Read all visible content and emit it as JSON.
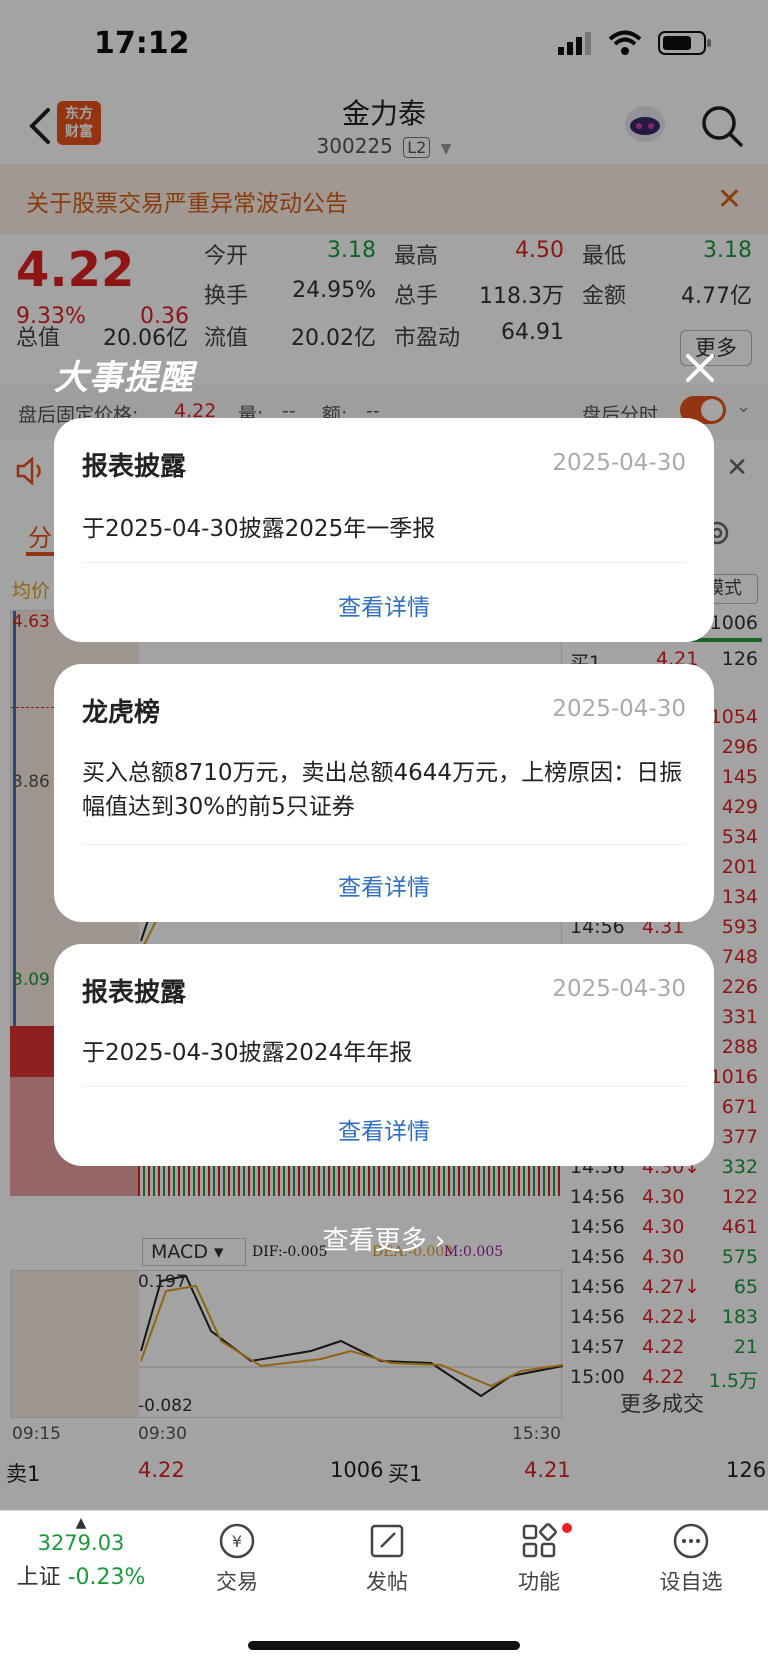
{
  "status": {
    "time": "17:12"
  },
  "nav": {
    "logo_line1": "东方",
    "logo_line2": "财富",
    "name": "金力泰",
    "code": "300225",
    "level": "L2"
  },
  "notice": {
    "text": "关于股票交易严重异常波动公告"
  },
  "quote": {
    "price": "4.22",
    "pct": "9.33%",
    "change": "0.36",
    "open_label": "今开",
    "open": "3.18",
    "high_label": "最高",
    "high": "4.50",
    "low_label": "最低",
    "low": "3.18",
    "turnover_label": "换手",
    "turnover": "24.95%",
    "volume_label": "总手",
    "volume": "118.3万",
    "amount_label": "金额",
    "amount": "4.77亿",
    "mktcap_label": "总值",
    "mktcap": "20.06亿",
    "float_label": "流值",
    "float": "20.02亿",
    "pe_label": "市盈动",
    "pe": "64.91",
    "more": "更多"
  },
  "after": {
    "label": "盘后固定价格:",
    "price": "4.22",
    "vol": "量:",
    "vol_v": "--",
    "amt": "额:",
    "amt_v": "--",
    "right": "盘后分时"
  },
  "tabs": {
    "first": "分",
    "mode": "模式"
  },
  "chart": {
    "avg_label": "均价",
    "y_top": "4.63",
    "y_mid": "3.86",
    "y_bot": "3.09",
    "macd": "MACD",
    "dif": "DIF:-0.005",
    "dea": "DEA:-0.008",
    "m": "M:0.005",
    "macd_top": "0.197",
    "macd_bot": "-0.082",
    "t0": "09:15",
    "t1": "09:30",
    "t2": "15:30"
  },
  "book_top": {
    "sell1_vol": "1006",
    "buy1": "买1",
    "buy1_price": "4.21",
    "buy1_vol": "126"
  },
  "ticks_hidden_right": [
    "1054",
    "296",
    "145",
    "429",
    "534",
    "201",
    "134"
  ],
  "ticks": [
    {
      "time": "14:56",
      "price": "4.31",
      "vol": "593"
    },
    {
      "time": "",
      "price": "",
      "vol": "748"
    },
    {
      "time": "",
      "price": "",
      "vol": "226"
    },
    {
      "time": "",
      "price": "",
      "vol": "331"
    },
    {
      "time": "",
      "price": "",
      "vol": "288"
    },
    {
      "time": "",
      "price": "",
      "vol": "1016"
    },
    {
      "time": "",
      "price": "",
      "vol": "671"
    },
    {
      "time": "",
      "price": "",
      "vol": "377"
    },
    {
      "time": "14:56",
      "price": "4.30↓",
      "vol": "332"
    },
    {
      "time": "14:56",
      "price": "4.30",
      "vol": "122"
    },
    {
      "time": "14:56",
      "price": "4.30",
      "vol": "461"
    },
    {
      "time": "14:56",
      "price": "4.30",
      "vol": "575"
    },
    {
      "time": "14:56",
      "price": "4.27↓",
      "vol": "65"
    },
    {
      "time": "14:56",
      "price": "4.22↓",
      "vol": "183"
    },
    {
      "time": "14:57",
      "price": "4.22",
      "vol": "21"
    },
    {
      "time": "15:00",
      "price": "4.22",
      "vol": "1.5万"
    }
  ],
  "more_trades": "更多成交",
  "orders": {
    "sell1": "卖1",
    "sell1_price": "4.22",
    "sell1_vol": "1006",
    "buy1": "买1",
    "buy1_price": "4.21",
    "buy1_vol": "126"
  },
  "bottom": {
    "index_value": "3279.03",
    "index_name": "上证",
    "index_pct": "-0.23%",
    "trade": "交易",
    "post": "发帖",
    "func": "功能",
    "watch": "设自选"
  },
  "overlay": {
    "title": "大事提醒",
    "cards": [
      {
        "title": "报表披露",
        "date": "2025-04-30",
        "body": "于2025-04-30披露2025年一季报",
        "link": "查看详情"
      },
      {
        "title": "龙虎榜",
        "date": "2025-04-30",
        "body": "买入总额8710万元，卖出总额4644万元，上榜原因：日振幅值达到30%的前5只证券",
        "link": "查看详情"
      },
      {
        "title": "报表披露",
        "date": "2025-04-30",
        "body": "于2025-04-30披露2024年年报",
        "link": "查看详情"
      }
    ],
    "see_more": "查看更多 ›"
  },
  "colors": {
    "up": "#dd2222",
    "down": "#1a9a3a",
    "brand": "#e8531d",
    "link": "#2f6fbf"
  }
}
